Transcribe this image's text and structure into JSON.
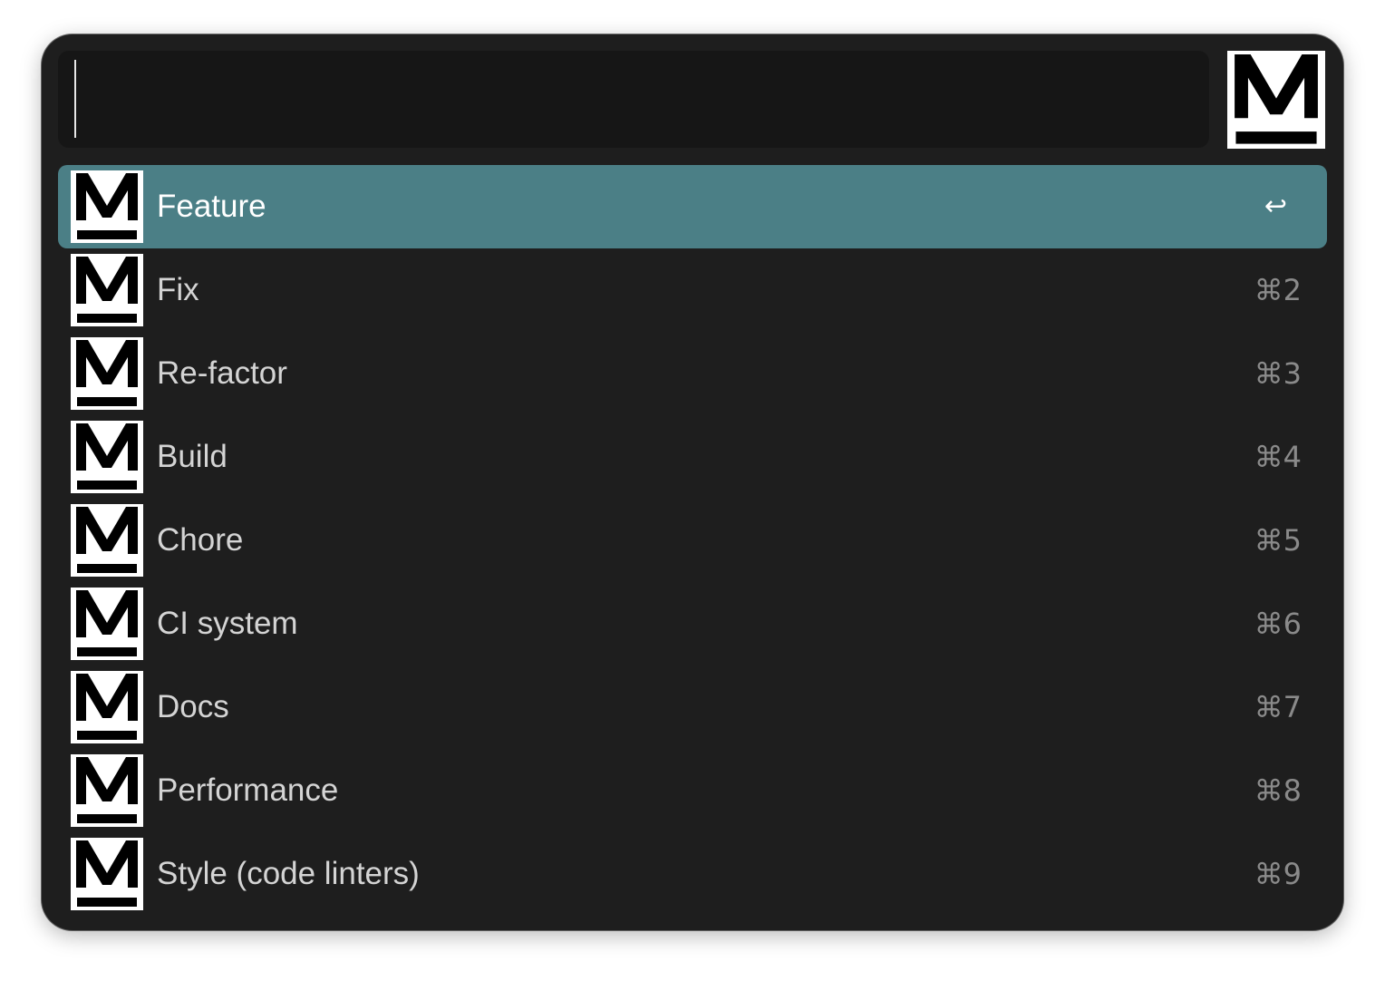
{
  "search": {
    "value": "",
    "placeholder": ""
  },
  "logo_icon": "m-logo-icon",
  "colors": {
    "window_bg": "#1e1e1e",
    "search_bg": "#161616",
    "selected_bg": "#4b7f86",
    "label_text": "#d4d4d4",
    "shortcut_text": "#8a8a8a"
  },
  "items": [
    {
      "label": "Feature",
      "shortcut": "↩",
      "selected": true
    },
    {
      "label": "Fix",
      "shortcut": "⌘2"
    },
    {
      "label": "Re-factor",
      "shortcut": "⌘3"
    },
    {
      "label": "Build",
      "shortcut": "⌘4"
    },
    {
      "label": "Chore",
      "shortcut": "⌘5"
    },
    {
      "label": "CI system",
      "shortcut": "⌘6"
    },
    {
      "label": "Docs",
      "shortcut": "⌘7"
    },
    {
      "label": "Performance",
      "shortcut": "⌘8"
    },
    {
      "label": "Style (code linters)",
      "shortcut": "⌘9"
    }
  ]
}
